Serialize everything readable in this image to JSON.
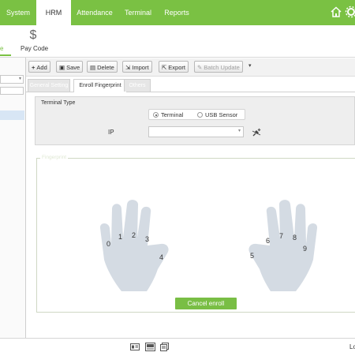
{
  "nav": {
    "items": [
      {
        "label": "System"
      },
      {
        "label": "HRM",
        "active": true
      },
      {
        "label": "Attendance"
      },
      {
        "label": "Terminal"
      },
      {
        "label": "Reports"
      }
    ],
    "home_icon": "home-icon",
    "settings_icon": "gear-icon"
  },
  "subnav": {
    "partial_tab": "e",
    "pay_code_label": "Pay Code",
    "pay_code_icon": "dollar-icon"
  },
  "toolbar": {
    "add": "Add",
    "save": "Save",
    "delete": "Delete",
    "import": "Import",
    "export": "Export",
    "batch_update": "Batch Update"
  },
  "tabs": {
    "general": "General Setting",
    "enroll": "Enroll Fingerprint",
    "others": "Others"
  },
  "terminal": {
    "legend": "Terminal Type",
    "option_terminal": "Terminal",
    "option_usb": "USB Sensor",
    "selected": "Terminal",
    "ip_label": "IP",
    "ip_value": ""
  },
  "fingerprint": {
    "legend": "Fingerprint",
    "left_fingers": [
      "0",
      "1",
      "2",
      "3",
      "4"
    ],
    "right_fingers": [
      "5",
      "6",
      "7",
      "8",
      "9"
    ],
    "cancel_label": "Cancel enroll"
  },
  "status": {
    "right_text": "Lo"
  },
  "colors": {
    "brand_green": "#7ac143",
    "hand_fill": "#d4dbe3"
  }
}
